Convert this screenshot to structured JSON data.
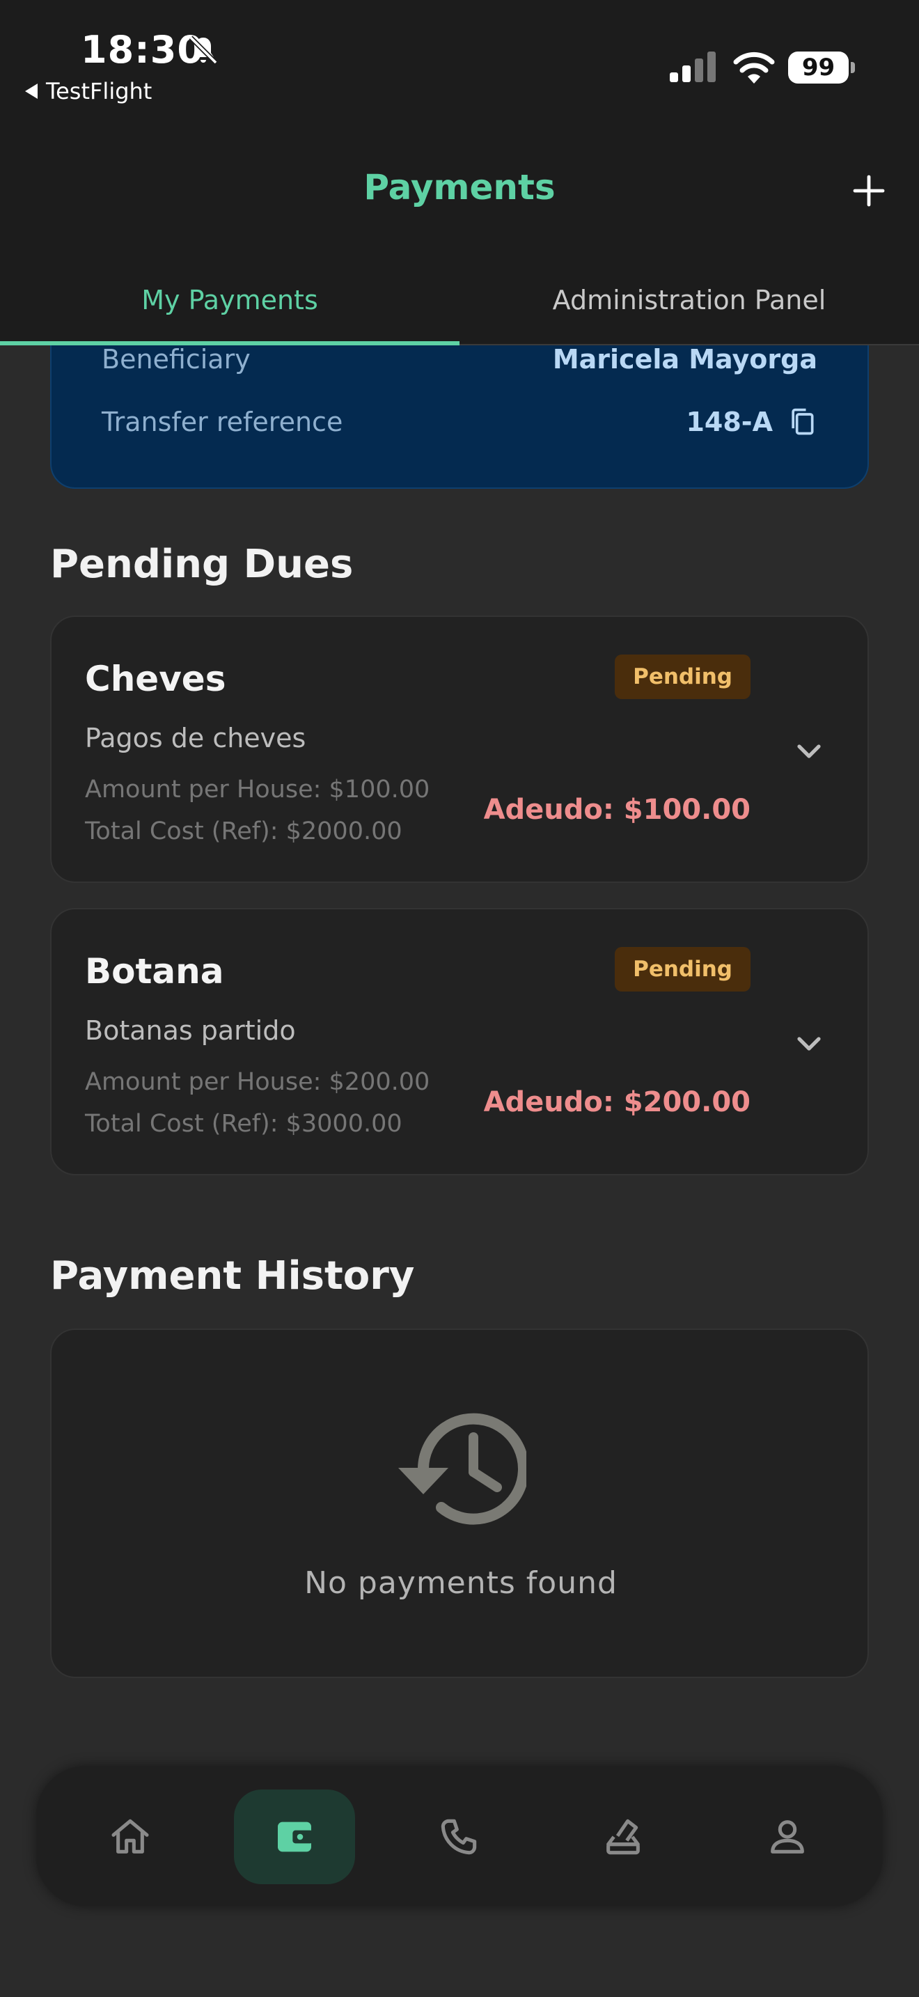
{
  "status_bar": {
    "time": "18:30",
    "back_app": "TestFlight",
    "battery": "99",
    "icons": [
      "bell-slash-icon",
      "signal-icon",
      "wifi-icon",
      "battery-icon"
    ]
  },
  "header": {
    "title": "Payments",
    "add_icon": "plus-icon"
  },
  "tabs": [
    {
      "label": "My Payments",
      "active": true
    },
    {
      "label": "Administration Panel",
      "active": false
    }
  ],
  "bank_info": {
    "beneficiary_label": "Beneficiary",
    "beneficiary_value": "Maricela Mayorga",
    "reference_label": "Transfer reference",
    "reference_value": "148-A",
    "copy_icon": "copy-icon"
  },
  "pending_dues": {
    "title": "Pending Dues",
    "items": [
      {
        "name": "Cheves",
        "status": "Pending",
        "description": "Pagos de cheves",
        "amount_per_house": "Amount per House: $100.00",
        "total_cost": "Total Cost (Ref): $2000.00",
        "adeudo": "Adeudo: $100.00"
      },
      {
        "name": "Botana",
        "status": "Pending",
        "description": "Botanas partido",
        "amount_per_house": "Amount per House: $200.00",
        "total_cost": "Total Cost (Ref): $3000.00",
        "adeudo": "Adeudo: $200.00"
      }
    ]
  },
  "payment_history": {
    "title": "Payment History",
    "empty_text": "No payments found",
    "empty_icon": "history-icon"
  },
  "bottom_nav": {
    "items": [
      {
        "icon": "home-icon",
        "active": false
      },
      {
        "icon": "wallet-icon",
        "active": true
      },
      {
        "icon": "phone-icon",
        "active": false
      },
      {
        "icon": "vote-box-icon",
        "active": false
      },
      {
        "icon": "person-icon",
        "active": false
      }
    ]
  },
  "colors": {
    "accent": "#5ed1a4",
    "background": "#2b2b2b",
    "card": "#222222",
    "bank_card": "#042a50",
    "pending_badge_bg": "#4a2d0c",
    "pending_badge_text": "#f1bf6a",
    "debt": "#ee8d8d"
  }
}
